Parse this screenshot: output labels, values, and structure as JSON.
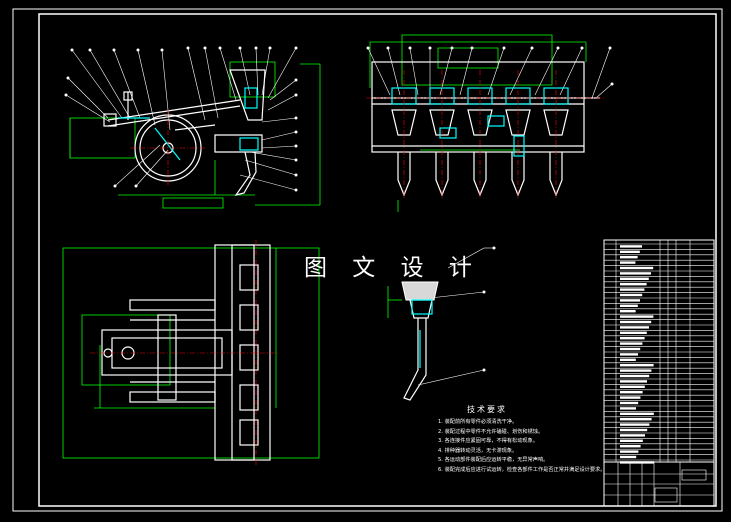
{
  "watermark": "图 文 设 计",
  "technical_requirements": {
    "title": "技术要求",
    "items": [
      "1. 装配前所有零件必须清洗干净。",
      "2. 装配过程中零件不允许磕碰、划伤和锈蚀。",
      "3. 各连接件应紧固可靠，不得有松动现象。",
      "4. 排种器转动灵活，无卡滞现象。",
      "5. 各运动部件装配后应运转平稳，无异常声响。",
      "6. 装配完成后应进行试运转，检查各部件工作是否正常并满足设计要求。"
    ]
  },
  "colors": {
    "background": "#000000",
    "frame": "#ffffff",
    "outline": "#ffffff",
    "dimension": "#00ff00",
    "hidden": "#00ffff",
    "center": "#ff0000",
    "text": "#ffffff"
  }
}
